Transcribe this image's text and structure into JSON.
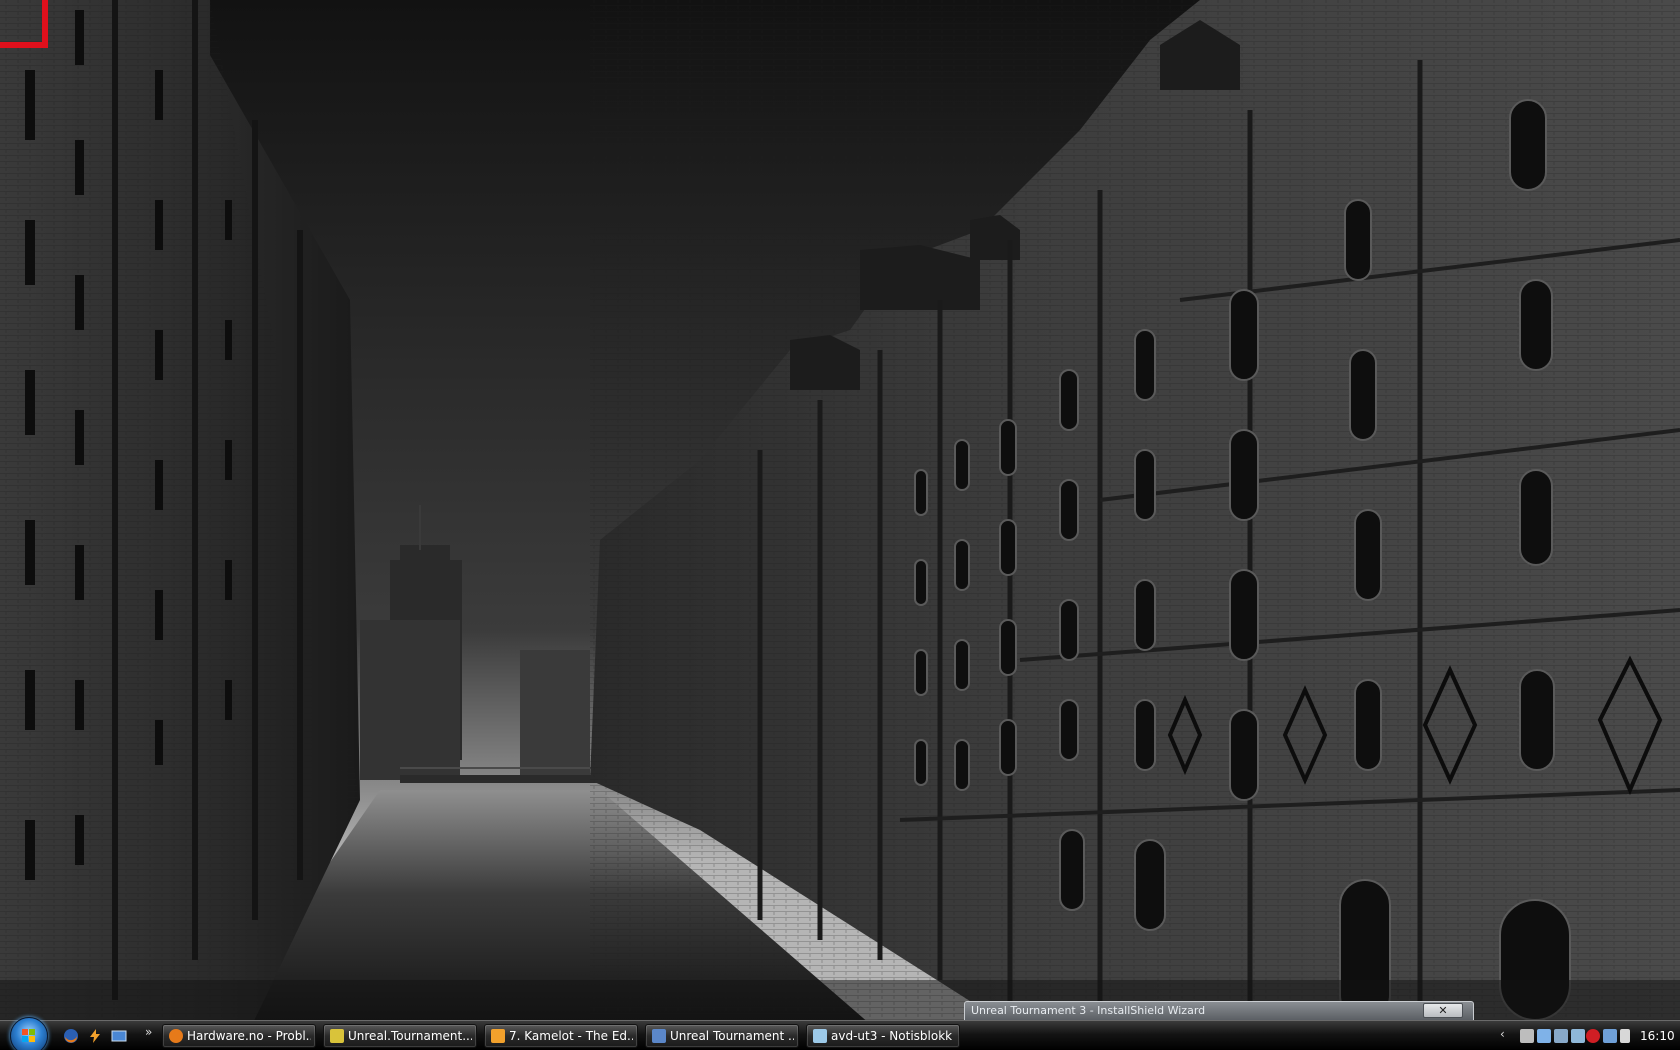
{
  "desktop": {
    "wallpaper": "Black and white photo of a canal between brick warehouse buildings"
  },
  "wizard": {
    "title": "Unreal Tournament 3 - InstallShield Wizard",
    "close_label": "✕"
  },
  "taskbar": {
    "start_icon": "windows-start-orb",
    "quicklaunch_more": "»",
    "quicklaunch": [
      {
        "name": "firefox-icon"
      },
      {
        "name": "winamp-icon"
      },
      {
        "name": "show-desktop-icon"
      }
    ],
    "tasks": [
      {
        "label": "Hardware.no - Probl...",
        "icon": "firefox-icon",
        "color": "#e67a1a"
      },
      {
        "label": "Unreal.Tournament....",
        "icon": "document-icon",
        "color": "#d9c33a"
      },
      {
        "label": "7. Kamelot - The Ed...",
        "icon": "winamp-icon",
        "color": "#f2a12c"
      },
      {
        "label": "Unreal Tournament ...",
        "icon": "installer-icon",
        "color": "#5b87c9"
      },
      {
        "label": "avd-ut3 - Notisblokk",
        "icon": "notepad-icon",
        "color": "#9cc9e8"
      }
    ],
    "tray": {
      "expand": "‹",
      "clock": "16:10",
      "icons": [
        {
          "name": "monitor-icon",
          "color": "#bdbdbd"
        },
        {
          "name": "network-icon",
          "color": "#7fb2e8"
        },
        {
          "name": "device-icon",
          "color": "#88a9c9"
        },
        {
          "name": "security-icon",
          "color": "#8fb8d8"
        },
        {
          "name": "antivirus-icon",
          "color": "#d01e24"
        },
        {
          "name": "network-connection-icon",
          "color": "#6fa0d8"
        },
        {
          "name": "volume-icon",
          "color": "#d8d8d8"
        }
      ]
    }
  }
}
